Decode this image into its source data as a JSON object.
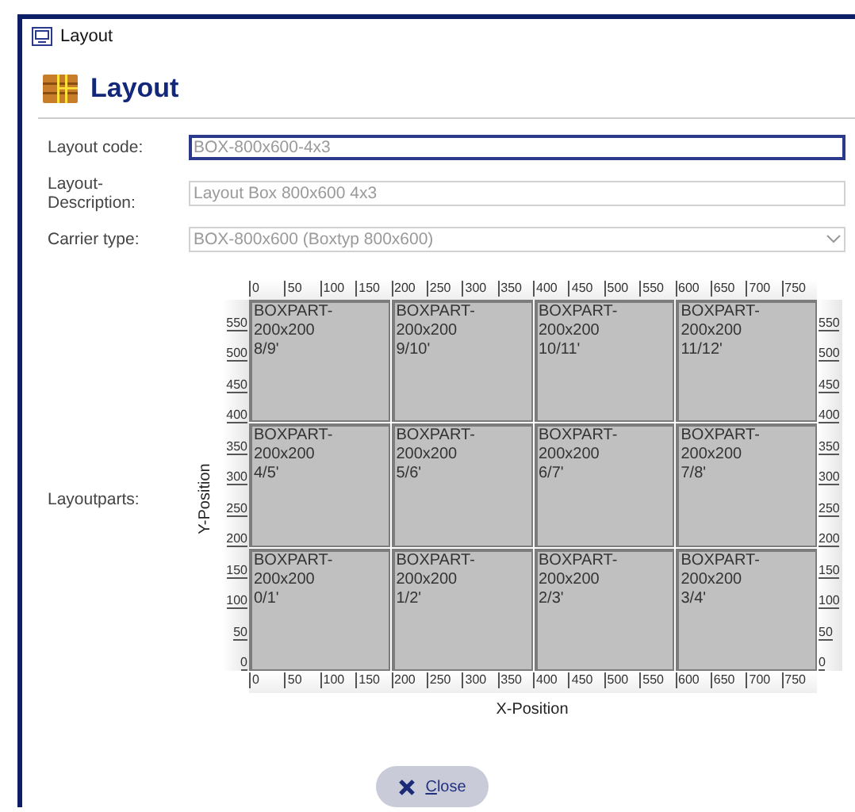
{
  "window": {
    "title": "Layout"
  },
  "header": {
    "title": "Layout"
  },
  "fields": [
    {
      "label": "Layout code:",
      "value": "BOX-800x600-4x3",
      "kind": "text",
      "focused": true
    },
    {
      "label": "Layout-Description:",
      "value": "Layout Box 800x600 4x3",
      "kind": "text",
      "focused": false
    },
    {
      "label": "Carrier type:",
      "value": "BOX-800x600 (Boxtyp 800x600)",
      "kind": "dropdown",
      "focused": false
    }
  ],
  "layoutparts": {
    "label": "Layoutparts:",
    "x_axis_label": "X-Position",
    "y_axis_label": "Y-Position",
    "top_ticks": [
      "0",
      "50",
      "100",
      "150",
      "200",
      "250",
      "300",
      "350",
      "400",
      "450",
      "500",
      "550",
      "600",
      "650",
      "700",
      "750"
    ],
    "bottom_ticks": [
      "0",
      "50",
      "100",
      "150",
      "200",
      "250",
      "300",
      "350",
      "400",
      "450",
      "500",
      "550",
      "600",
      "650",
      "700",
      "750"
    ],
    "left_ticks": [
      "550",
      "500",
      "450",
      "400",
      "350",
      "300",
      "250",
      "200",
      "150",
      "100",
      "50",
      "0"
    ],
    "right_ticks": [
      "550",
      "500",
      "450",
      "400",
      "350",
      "300",
      "250",
      "200",
      "150",
      "100",
      "50",
      "0"
    ],
    "rows": [
      [
        {
          "name": "BOXPART-200x200",
          "position": "8/9'"
        },
        {
          "name": "BOXPART-200x200",
          "position": "9/10'"
        },
        {
          "name": "BOXPART-200x200",
          "position": "10/11'"
        },
        {
          "name": "BOXPART-200x200",
          "position": "11/12'"
        }
      ],
      [
        {
          "name": "BOXPART-200x200",
          "position": "4/5'"
        },
        {
          "name": "BOXPART-200x200",
          "position": "5/6'"
        },
        {
          "name": "BOXPART-200x200",
          "position": "6/7'"
        },
        {
          "name": "BOXPART-200x200",
          "position": "7/8'"
        }
      ],
      [
        {
          "name": "BOXPART-200x200",
          "position": "0/1'"
        },
        {
          "name": "BOXPART-200x200",
          "position": "1/2'"
        },
        {
          "name": "BOXPART-200x200",
          "position": "2/3'"
        },
        {
          "name": "BOXPART-200x200",
          "position": "3/4'"
        }
      ]
    ]
  },
  "buttons": [
    {
      "label": "Close"
    }
  ]
}
